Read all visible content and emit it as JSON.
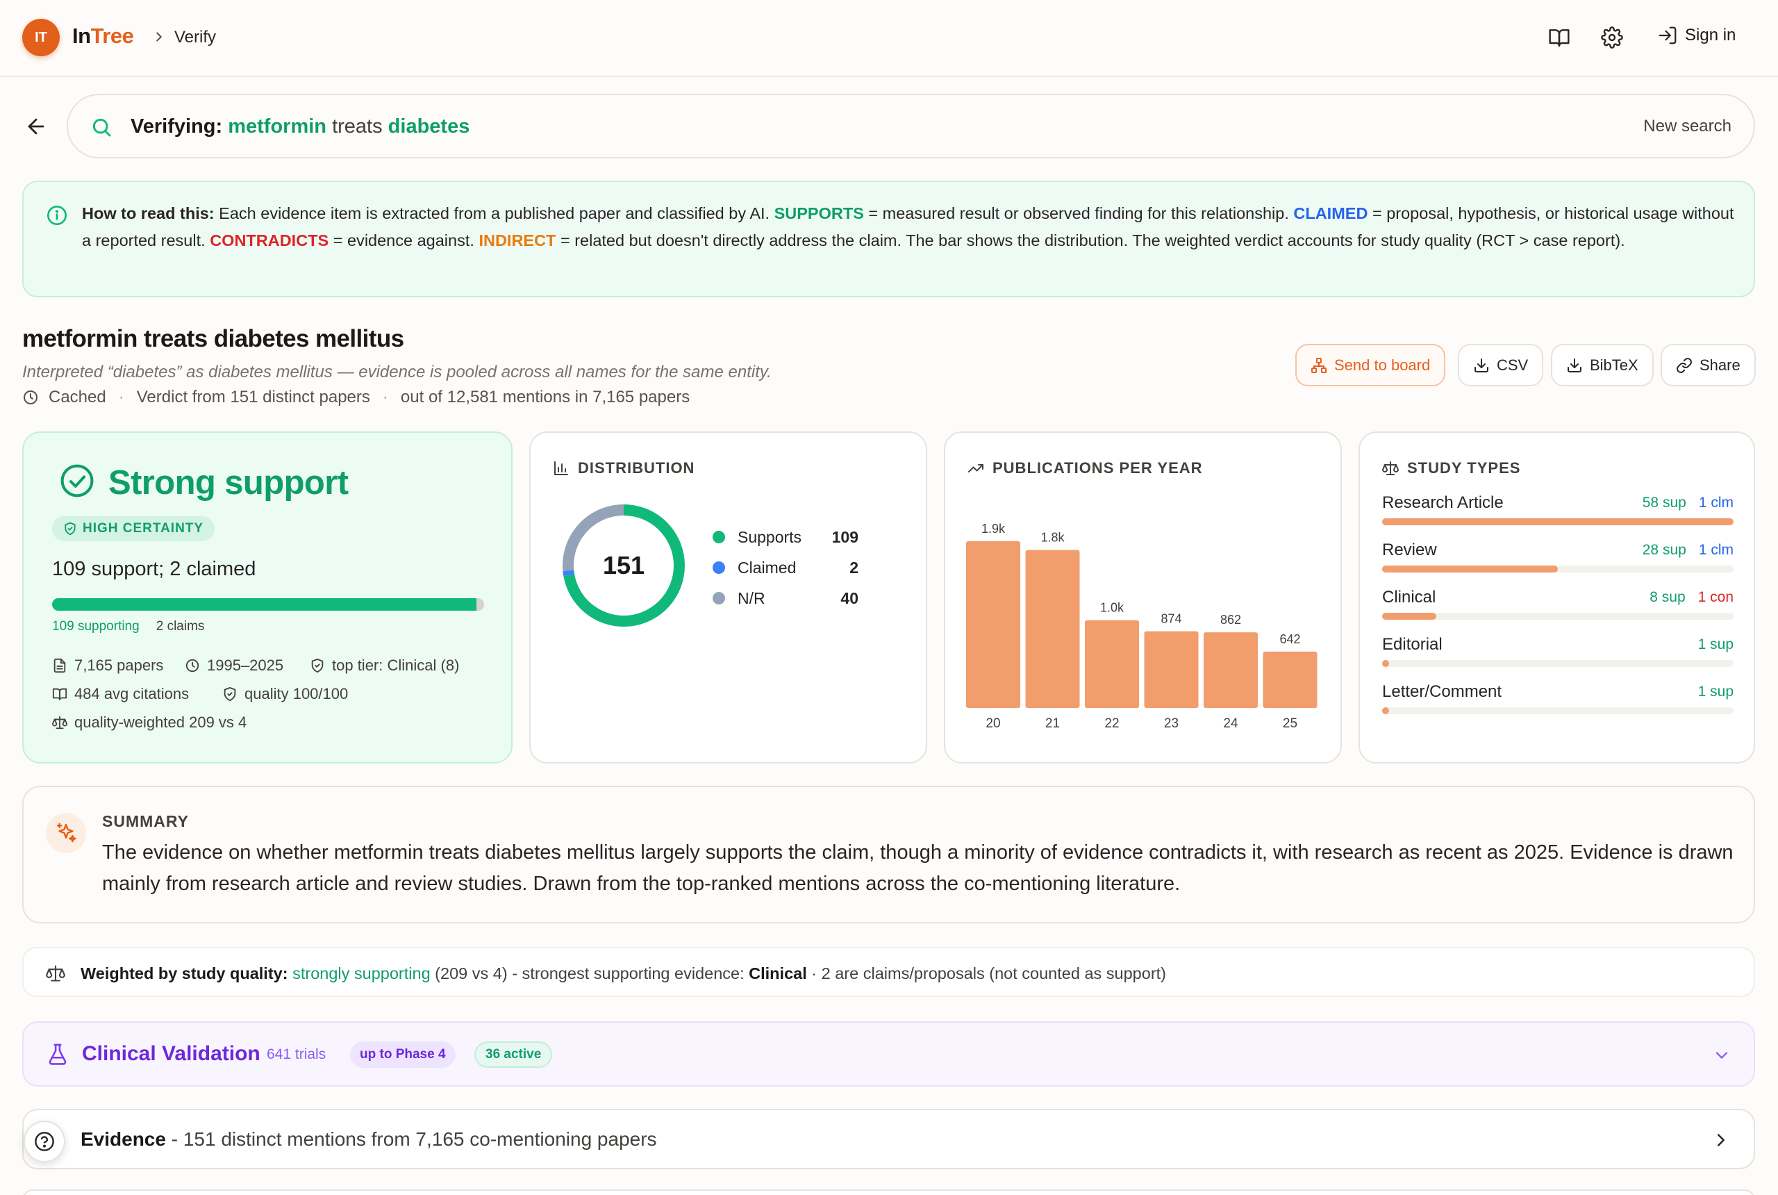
{
  "header": {
    "logo_initials": "IT",
    "logo_part1": "In",
    "logo_part2": "Tree",
    "breadcrumb": "Verify",
    "sign_in": "Sign in"
  },
  "search": {
    "label": "Verifying:",
    "subject": "metformin",
    "relation": "treats",
    "object": "diabetes",
    "new_search": "New search"
  },
  "info": {
    "lead": "How to read this:",
    "t1": " Each evidence item is extracted from a published paper and classified by AI. ",
    "supports": "SUPPORTS",
    "t2": " = measured result or observed finding for this relationship. ",
    "claimed": "CLAIMED",
    "t3": " = proposal, hypothesis, or historical usage without a reported result. ",
    "contradicts": "CONTRADICTS",
    "t4": " = evidence against. ",
    "indirect": "INDIRECT",
    "t5": " = related but doesn't directly address the claim. The bar shows the distribution. The weighted verdict accounts for study quality (RCT > case report)."
  },
  "claim": {
    "title": "metformin treats diabetes mellitus",
    "interpretation": "Interpreted “diabetes” as diabetes mellitus — evidence is pooled across all names for the same entity.",
    "cached": "Cached",
    "verdict_from": "Verdict from 151 distinct papers",
    "mentions": "out of 12,581 mentions in 7,165 papers"
  },
  "actions": {
    "send_to_board": "Send to board",
    "csv": "CSV",
    "bibtex": "BibTeX",
    "share": "Share"
  },
  "verdict": {
    "title": "Strong support",
    "certainty": "HIGH CERTAINTY",
    "summary": "109 support; 2 claimed",
    "support_fraction": 0.982,
    "supporting_label": "109 supporting",
    "claims_label": "2 claims",
    "papers": "7,165 papers",
    "years": "1995–2025",
    "top_tier": "top tier: Clinical (8)",
    "citations": "484 avg citations",
    "quality": "quality 100/100",
    "weighted": "quality-weighted 209 vs 4"
  },
  "distribution": {
    "heading": "DISTRIBUTION",
    "total": "151",
    "items": [
      {
        "label": "Supports",
        "value": 109,
        "color": "#10b97a"
      },
      {
        "label": "Claimed",
        "value": 2,
        "color": "#3b82f6"
      },
      {
        "label": "N/R",
        "value": 40,
        "color": "#94a3b8"
      }
    ]
  },
  "publications": {
    "heading": "PUBLICATIONS PER YEAR"
  },
  "chart_data": {
    "type": "bar",
    "categories": [
      "20",
      "21",
      "22",
      "23",
      "24",
      "25"
    ],
    "values": [
      1900,
      1800,
      1000,
      874,
      862,
      642
    ],
    "data_labels": [
      "1.9k",
      "1.8k",
      "1.0k",
      "874",
      "862",
      "642"
    ],
    "ylim": [
      0,
      1900
    ],
    "grid": false,
    "color": "#f19d6c"
  },
  "study_types": {
    "heading": "STUDY TYPES",
    "rows": [
      {
        "name": "Research Article",
        "sup": "58 sup",
        "clm": "1 clm",
        "con": "",
        "fraction": 1.0
      },
      {
        "name": "Review",
        "sup": "28 sup",
        "clm": "1 clm",
        "con": "",
        "fraction": 0.5
      },
      {
        "name": "Clinical",
        "sup": "8 sup",
        "clm": "",
        "con": "1 con",
        "fraction": 0.155
      },
      {
        "name": "Editorial",
        "sup": "1 sup",
        "clm": "",
        "con": "",
        "fraction": 0.02
      },
      {
        "name": "Letter/Comment",
        "sup": "1 sup",
        "clm": "",
        "con": "",
        "fraction": 0.02
      }
    ]
  },
  "summary": {
    "heading": "SUMMARY",
    "text": "The evidence on whether metformin treats diabetes mellitus largely supports the claim, though a minority of evidence contradicts it, with research as recent as 2025. Evidence is drawn mainly from research article and review studies. Drawn from the top-ranked mentions across the co-mentioning literature."
  },
  "weighted": {
    "lead": "Weighted by study quality:",
    "verdict": "strongly supporting",
    "mid": " (209 vs 4) - strongest supporting evidence: ",
    "tier": "Clinical",
    "tail": " · 2 are claims/proposals (not counted as support)"
  },
  "clinical": {
    "title": "Clinical Validation",
    "trials": "641 trials",
    "phase": "up to Phase 4",
    "active": "36 active"
  },
  "evidence": {
    "title": "Evidence",
    "desc": " - 151 distinct mentions from 7,165 co-mentioning papers"
  },
  "colors": {
    "brand": "#e35f1c",
    "support": "#10b97a",
    "claimed": "#2563eb",
    "contradicts": "#dc2626",
    "indirect": "#ea7a0c",
    "clinical": "#6d28d9"
  }
}
